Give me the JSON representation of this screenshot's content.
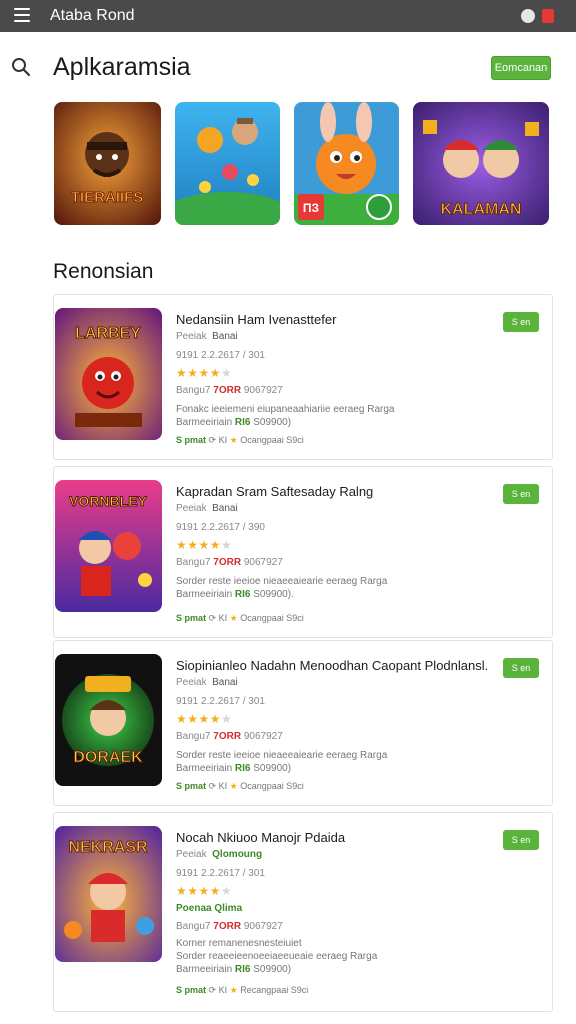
{
  "topbar": {
    "title": "Ataba Rond",
    "dot_label": "●"
  },
  "header": {
    "title": "Aplkaramsia",
    "action_label": "Eomcanan"
  },
  "featured": [
    {
      "label": "TIERAIIFS",
      "accent": "#d4572a"
    },
    {
      "label": "",
      "accent": "#2fa3e0"
    },
    {
      "label": "ПЗ",
      "accent": "#f08a24"
    },
    {
      "label": "KALAMAN",
      "accent": "#6a3fb2"
    }
  ],
  "section": {
    "title": "Renonsian"
  },
  "cards": [
    {
      "title": "Nedansiin Ham Ivenasttefer",
      "dev_prefix": "Peeiak",
      "dev_name": "Banai",
      "meta": "9191 2.2.2617 / 301",
      "stars": 4,
      "price_prefix": "Bangu7",
      "price_value": "7ORR",
      "price_suffix": "9067927",
      "desc_line1": "Fonakc ieeiemeni eiupaneaahiariie eeraeg Rarga",
      "desc_line2_prefix": "Barmeeiriain",
      "desc_line2_green": "RI6",
      "desc_line2_suffix": "S09900)",
      "foot_prefix": "S pmat",
      "foot_mid": "KI",
      "foot_suffix": "Ocangpaai S9ci",
      "button": "S en",
      "thumb_label": "LARBEY"
    },
    {
      "title": "Kapradan Sram Saftesaday Ralng",
      "dev_prefix": "Peeiak",
      "dev_name": "Banai",
      "meta": "9191 2.2.2617 / 390",
      "stars": 4,
      "price_prefix": "Bangu7",
      "price_value": "7ORR",
      "price_suffix": "9067927",
      "desc_line1": "Sorder reste ieeioe nieaeeaiearie eeraeg Rarga",
      "desc_line2_prefix": "Barmeeiriain",
      "desc_line2_green": "RI6",
      "desc_line2_suffix": "S09900).",
      "foot_prefix": "S pmat",
      "foot_mid": "KI",
      "foot_suffix": "Ocangpaai S9ci",
      "button": "S en",
      "thumb_label": "VORNBLEY"
    },
    {
      "title": "Siopinianleo Nadahn Menoodhan Caopant Plodnlansl.",
      "dev_prefix": "Peeiak",
      "dev_name": "Banai",
      "meta": "9191 2.2.2617 / 301",
      "stars": 4,
      "price_prefix": "Bangu7",
      "price_value": "7ORR",
      "price_suffix": "9067927",
      "desc_line1": "Sorder reste ieeioe nieaeeaiearie eeraeg Rarga",
      "desc_line2_prefix": "Barmeeiriain",
      "desc_line2_green": "RI6",
      "desc_line2_suffix": "S09900)",
      "foot_prefix": "S pmat",
      "foot_mid": "KI",
      "foot_suffix": "Ocangpaai S9ci",
      "button": "S en",
      "thumb_label": "DORAEK"
    },
    {
      "title": "Nocah Nkiuoo Manojr Pdaida",
      "dev_prefix": "Peeiak",
      "dev_name": "Qlomoung",
      "meta": "9191 2.2.2617 / 301",
      "stars": 4,
      "extra": "Poenaa Qlima",
      "price_prefix": "Bangu7",
      "price_value": "7ORR",
      "price_suffix": "9067927",
      "desc_line1": "Korner remanenesnesteiuiet",
      "desc_line1b": "Sorder reaeeieenoeeiaeeueaie eeraeg Rarga",
      "desc_line2_prefix": "Barmeeiriain",
      "desc_line2_green": "RI6",
      "desc_line2_suffix": "S09900)",
      "foot_prefix": "S pmat",
      "foot_mid": "KI",
      "foot_suffix": "Recangpaai S9ci",
      "button": "S en",
      "thumb_label": "NEKRASR"
    }
  ]
}
